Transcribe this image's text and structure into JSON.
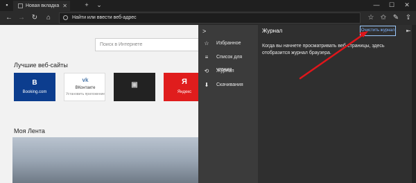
{
  "browser": {
    "tab": {
      "title": "Новая вкладка",
      "close": "✕"
    },
    "new_tab": "+",
    "tab_menu": "⌄",
    "window_controls": [
      "—",
      "☐",
      "✕"
    ]
  },
  "navbar": {
    "back": "←",
    "forward": "→",
    "refresh": "↻",
    "home": "⌂",
    "address_placeholder": "Найти или ввести веб-адрес",
    "right_icons": [
      "☆",
      "✩",
      "✎",
      "⇪",
      "⋯"
    ]
  },
  "newtab": {
    "search_placeholder": "Поиск в Интернете",
    "best_sites_heading": "Лучшие веб-сайты",
    "tiles": [
      {
        "name": "Booking.com",
        "glyph": "B",
        "bg": "#0c3d8e"
      },
      {
        "name": "ВКонтакте",
        "glyph": "vk",
        "sub": "Установить приложение",
        "bg": "#ffffff"
      },
      {
        "name": "",
        "glyph": "▣",
        "bg": "#222222"
      },
      {
        "name": "Яндекс",
        "glyph": "Я",
        "bg": "#e01d1d"
      }
    ],
    "feed_heading": "Моя Лента"
  },
  "hub": {
    "toggle": ">",
    "menu": [
      {
        "label": "Избранное",
        "icon": "☆"
      },
      {
        "label": "Список для чтения",
        "icon": "≡"
      },
      {
        "label": "Журнал",
        "icon": "⟲"
      },
      {
        "label": "Скачивания",
        "icon": "⬇"
      }
    ],
    "title": "Журнал",
    "clear_label": "Очистить журнал",
    "pin": "⇤",
    "message": "Когда вы начнете просматривать веб-страницы, здесь отобразится журнал браузера."
  },
  "colors": {
    "accent": "#7fb4ff",
    "annotation_arrow": "#e0161b"
  }
}
